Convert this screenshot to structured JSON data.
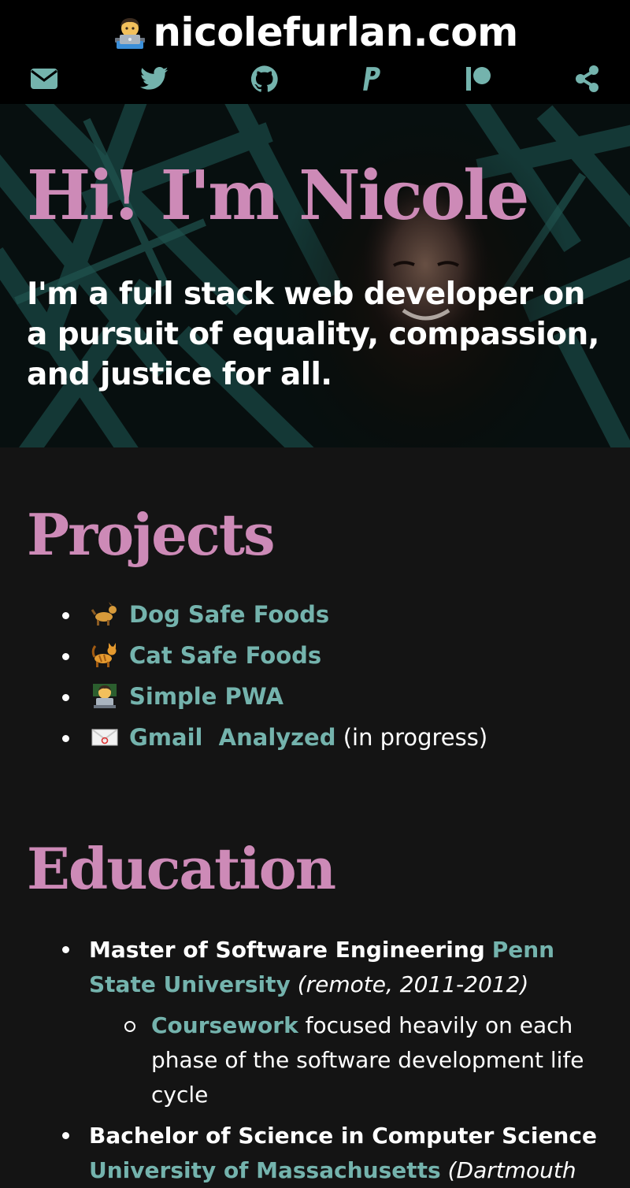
{
  "header": {
    "site_title": "nicolefurlan.com",
    "title_emoji": "technologist-emoji",
    "social_links": [
      {
        "name": "email-icon"
      },
      {
        "name": "twitter-icon"
      },
      {
        "name": "github-icon"
      },
      {
        "name": "paypal-icon"
      },
      {
        "name": "patreon-icon"
      },
      {
        "name": "share-icon"
      }
    ]
  },
  "hero": {
    "title": "Hi! I'm Nicole",
    "subtitle": "I'm a full stack web developer on a pursuit of equality, compassion, and justice for all."
  },
  "projects": {
    "heading": "Projects",
    "items": [
      {
        "emoji": "dog-emoji",
        "label": "Dog Safe Foods",
        "note": ""
      },
      {
        "emoji": "cat-emoji",
        "label": "Cat Safe Foods",
        "note": ""
      },
      {
        "emoji": "technologist-emoji",
        "label": "Simple PWA",
        "note": ""
      },
      {
        "emoji": "envelope-emoji",
        "label": "Gmail  Analyzed",
        "note": " (in progress)"
      }
    ]
  },
  "education": {
    "heading": "Education",
    "items": [
      {
        "degree": "Master of Software Engineering",
        "school": "Penn State University",
        "note": "(remote, 2011-2012)",
        "sub": [
          {
            "link": "Coursework",
            "text": " focused heavily on each phase of the software development life cycle"
          }
        ]
      },
      {
        "degree": "Bachelor of Science in Computer Science",
        "school": "University of Massachusetts",
        "note": "(Dartmouth",
        "sub": []
      }
    ]
  },
  "colors": {
    "accent_pink": "#cd8ab7",
    "accent_teal": "#74b3ad",
    "background": "#141414",
    "header_background": "#000000"
  }
}
